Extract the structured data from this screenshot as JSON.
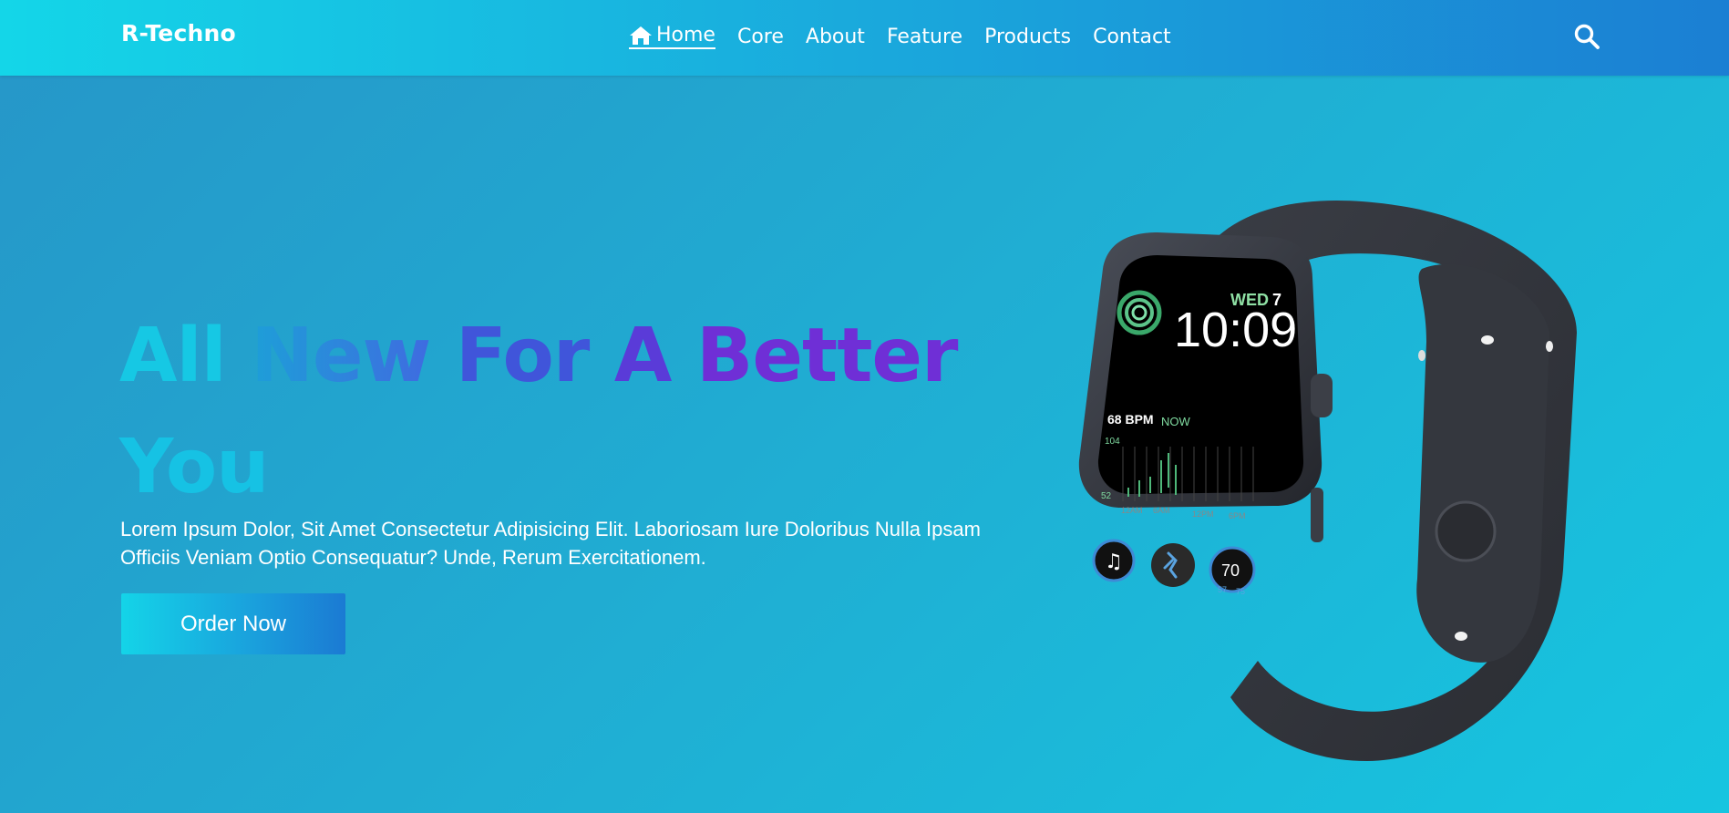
{
  "brand": {
    "logo": "R-Techno"
  },
  "nav": {
    "items": [
      {
        "label": "Home",
        "icon": "home-icon",
        "active": true
      },
      {
        "label": "Core"
      },
      {
        "label": "About"
      },
      {
        "label": "Feature"
      },
      {
        "label": "Products"
      },
      {
        "label": "Contact"
      }
    ],
    "search_icon": "search-icon"
  },
  "hero": {
    "title_words": [
      "All",
      "New",
      "For",
      "A",
      "Better",
      "You"
    ],
    "description": "Lorem Ipsum Dolor, Sit Amet Consectetur Adipisicing Elit. Laboriosam Iure Doloribus Nulla Ipsam Officiis Veniam Optio Consequatur? Unde, Rerum Exercitationem.",
    "cta_label": "Order Now"
  },
  "watch": {
    "day": "WED",
    "date": "7",
    "time": "10:09",
    "bpm": "68 BPM",
    "bpm_status": "NOW",
    "hr_max": "104",
    "hr_min": "52",
    "chart_times": [
      "12AM",
      "6AM",
      "12PM",
      "6PM"
    ],
    "complication_value": "70",
    "complication_low": "57",
    "complication_high": "75"
  },
  "colors": {
    "header_start": "#14d6e8",
    "header_end": "#1b7fd3",
    "title_purple": "#6f2fd6",
    "title_cyan": "#16c8e4"
  }
}
